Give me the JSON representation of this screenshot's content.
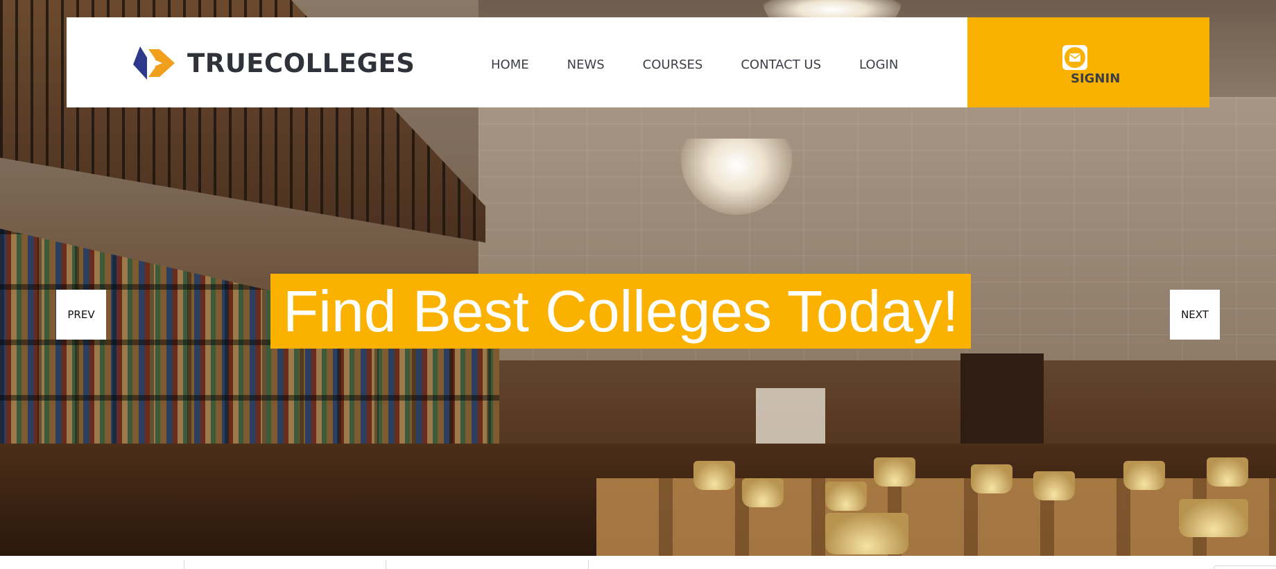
{
  "brand": {
    "name": "TRUECOLLEGES",
    "accent_color": "#fbb100",
    "logo_colors": [
      "#2d3a8c",
      "#f0a01c"
    ]
  },
  "nav": {
    "items": [
      {
        "label": "HOME"
      },
      {
        "label": "NEWS"
      },
      {
        "label": "COURSES"
      },
      {
        "label": "CONTACT US"
      },
      {
        "label": "LOGIN"
      }
    ]
  },
  "signin": {
    "label": "SIGNIN",
    "icon": "mail-icon"
  },
  "hero": {
    "headline": "Find Best Colleges Today!",
    "prev_label": "PREV",
    "next_label": "NEXT",
    "background": "library-reading-room-photo"
  }
}
